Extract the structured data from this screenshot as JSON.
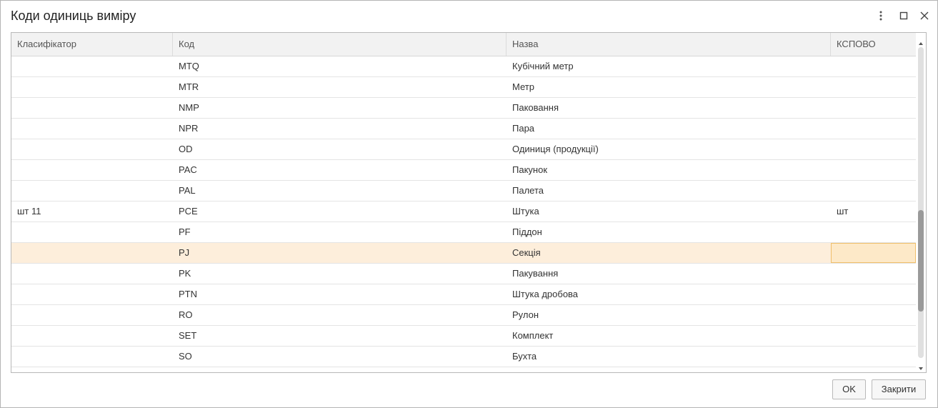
{
  "window": {
    "title": "Коди одиниць виміру",
    "controls": [
      "more-options",
      "maximize",
      "close"
    ]
  },
  "table": {
    "columns": [
      "Класифікатор",
      "Код",
      "Назва",
      "КСПОВО"
    ],
    "rows": [
      {
        "classifier": "",
        "code": "MTQ",
        "name": "Кубічний метр",
        "kspovo": ""
      },
      {
        "classifier": "",
        "code": "MTR",
        "name": "Метр",
        "kspovo": ""
      },
      {
        "classifier": "",
        "code": "NMP",
        "name": "Паковання",
        "kspovo": ""
      },
      {
        "classifier": "",
        "code": "NPR",
        "name": "Пара",
        "kspovo": ""
      },
      {
        "classifier": "",
        "code": "OD",
        "name": "Одиниця (продукції)",
        "kspovo": ""
      },
      {
        "classifier": "",
        "code": "PAC",
        "name": "Пакунок",
        "kspovo": ""
      },
      {
        "classifier": "",
        "code": "PAL",
        "name": "Палета",
        "kspovo": ""
      },
      {
        "classifier": "шт 11",
        "code": "PCE",
        "name": "Штука",
        "kspovo": "шт"
      },
      {
        "classifier": "",
        "code": "PF",
        "name": "Піддон",
        "kspovo": ""
      },
      {
        "classifier": "",
        "code": "PJ",
        "name": "Секція",
        "kspovo": "",
        "selected": true
      },
      {
        "classifier": "",
        "code": "PK",
        "name": "Пакування",
        "kspovo": ""
      },
      {
        "classifier": "",
        "code": "PTN",
        "name": "Штука дробова",
        "kspovo": ""
      },
      {
        "classifier": "",
        "code": "RO",
        "name": "Рулон",
        "kspovo": ""
      },
      {
        "classifier": "",
        "code": "SET",
        "name": "Комплект",
        "kspovo": ""
      },
      {
        "classifier": "",
        "code": "SO",
        "name": "Бухта",
        "kspovo": ""
      }
    ],
    "selected_row_color": "#fdeedb",
    "focused_cell_border": "#f0bf6a"
  },
  "footer": {
    "ok_label": "OK",
    "close_label": "Закрити"
  }
}
